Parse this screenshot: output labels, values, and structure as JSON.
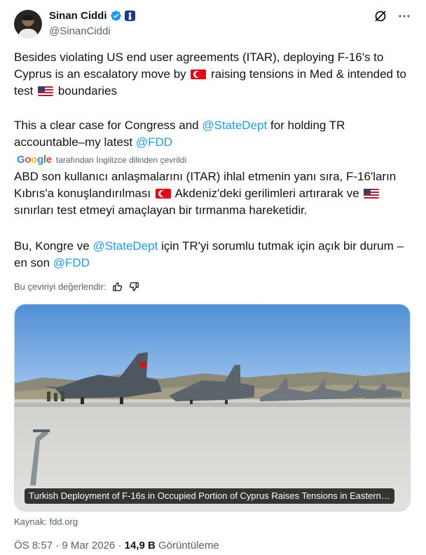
{
  "author": {
    "name": "Sinan Ciddi",
    "handle": "@SinanCiddi",
    "verified_color": "#1d9bf0"
  },
  "header_icons": [
    "grok-icon",
    "more-icon"
  ],
  "tweet": {
    "p1_a": "Besides violating US end user agreements (ITAR),  deploying F-16's to Cyprus is an escalatory move by",
    "p1_b": "raising tensions in Med & intended to test",
    "p1_c": "boundaries",
    "p2_a": "This a clear case for Congress and",
    "p2_mention1": "@StateDept",
    "p2_b": "for holding TR accountable–my latest",
    "p2_mention2": "@FDD"
  },
  "translation": {
    "provider": "Google",
    "note": "tarafından İngilizce dilinden çevrildi",
    "p1_a": "ABD son kullanıcı anlaşmalarını (ITAR) ihlal etmenin yanı sıra, F-16'ların Kıbrıs'a konuşlandırılması",
    "p1_b": "Akdeniz'deki gerilimleri artırarak ve",
    "p1_c": "sınırları test etmeyi amaçlayan bir tırmanma hareketidir.",
    "p2_a": "Bu, Kongre ve",
    "p2_mention1": "@StateDept",
    "p2_b": "için TR'yi sorumlu tutmak için açık bir durum – en son",
    "p2_mention2": "@FDD",
    "rate_label": "Bu çeviriyi değerlendir:"
  },
  "card": {
    "caption": "Turkish Deployment of F-16s in Occupied Portion of Cyprus Raises Tensions in Eastern…",
    "source": "Kaynak: fdd.org"
  },
  "meta": {
    "time": "ÖS 8:57",
    "sep1": " · ",
    "date": "9 Mar 2026",
    "sep2": " · ",
    "views_count": "14,9 B",
    "views_label": " Görüntüleme"
  },
  "colors": {
    "link": "#1d9bf0",
    "text": "#0f1419",
    "secondary": "#536471"
  }
}
